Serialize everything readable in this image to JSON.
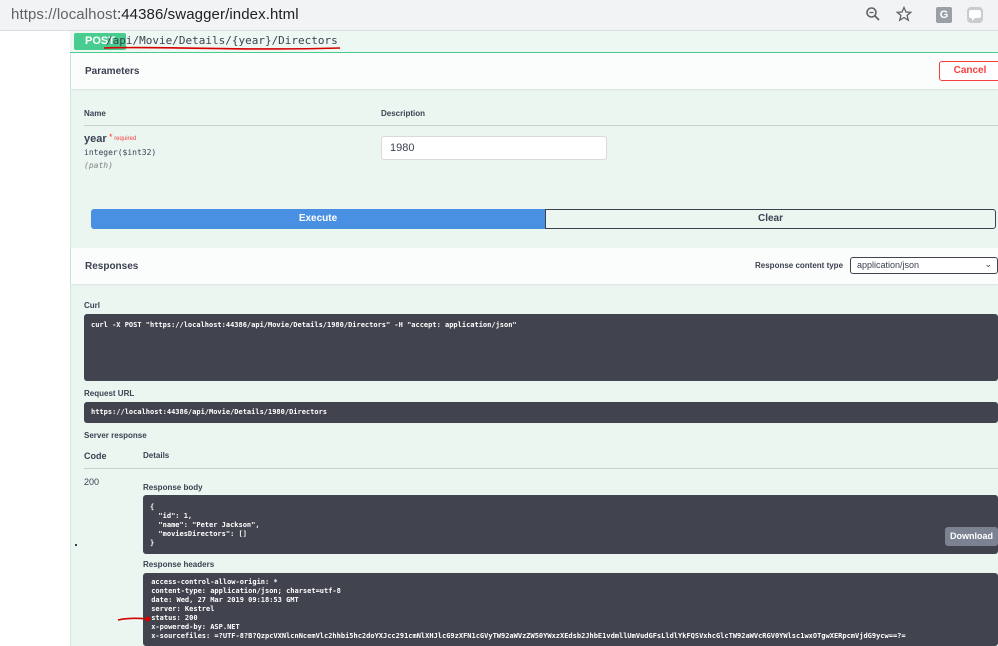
{
  "browser": {
    "url_host": "https://localhost",
    "url_rest": ":44386/swagger/index.html",
    "icons": [
      "zoom-icon",
      "star-icon",
      "extension-g-icon",
      "extension-chat-icon"
    ],
    "ext_g": "G"
  },
  "operation": {
    "method": "POST",
    "path": "/api/Movie/Details/{year}/Directors",
    "method_color": "#49cc90"
  },
  "parameters": {
    "title": "Parameters",
    "cancel_label": "Cancel",
    "col_name": "Name",
    "col_description": "Description",
    "items": [
      {
        "name": "year",
        "required_mark": "*",
        "required_label": "required",
        "type": "integer($int32)",
        "in": "(path)",
        "value": "1980"
      }
    ]
  },
  "actions": {
    "execute_label": "Execute",
    "clear_label": "Clear",
    "execute_color": "#4990e2"
  },
  "responses": {
    "title": "Responses",
    "content_type_label": "Response content type",
    "content_type_value": "application/json",
    "curl_label": "Curl",
    "curl": "curl -X POST \"https://localhost:44386/api/Movie/Details/1980/Directors\" -H \"accept: application/json\"",
    "request_url_label": "Request URL",
    "request_url": "https://localhost:44386/api/Movie/Details/1980/Directors",
    "server_response_label": "Server response",
    "code_header": "Code",
    "details_header": "Details",
    "code": "200",
    "body_label": "Response body",
    "body": "{\n  \"id\": 1,\n  \"name\": \"Peter Jackson\",\n  \"moviesDirectors\": []\n}",
    "download_label": "Download",
    "headers_label": "Response headers",
    "headers": " access-control-allow-origin: *\n content-type: application/json; charset=utf-8\n date: Wed, 27 Mar 2019 09:18:53 GMT\n server: Kestrel\n status: 200\n x-powered-by: ASP.NET\n x-sourcefiles: =?UTF-8?B?QzpcVXNlcnNcemVlc2hhbi5hc2doYXJcc291cmNlXHJlcG9zXFN1cGVyTW92aWVzZW50YWxzXEdsb2JhbE1vdmllUmVudGFsLldlYkFQSVxhcGlcTW92aWVcRGV0YWlsc1wxOTgwXERpcmVjdG9ycw==?="
  },
  "colors": {
    "annotation_red": "#d50000"
  }
}
